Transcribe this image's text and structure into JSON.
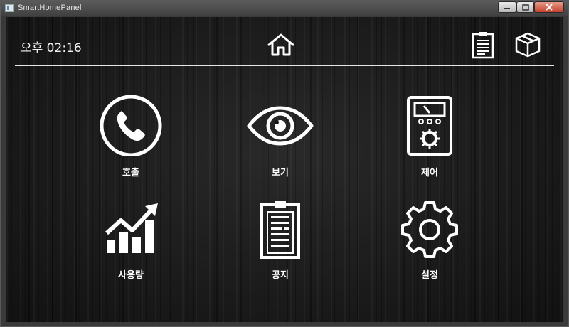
{
  "window": {
    "title": "SmartHomePanel"
  },
  "header": {
    "time": "오후 02:16"
  },
  "tiles": [
    {
      "label": "호출",
      "icon": "phone-icon"
    },
    {
      "label": "보기",
      "icon": "eye-icon"
    },
    {
      "label": "제어",
      "icon": "control-panel-icon"
    },
    {
      "label": "사용량",
      "icon": "usage-chart-icon"
    },
    {
      "label": "공지",
      "icon": "notice-clipboard-icon"
    },
    {
      "label": "설정",
      "icon": "gear-icon"
    }
  ],
  "colors": {
    "foreground": "#ffffff",
    "background": "#161616"
  }
}
